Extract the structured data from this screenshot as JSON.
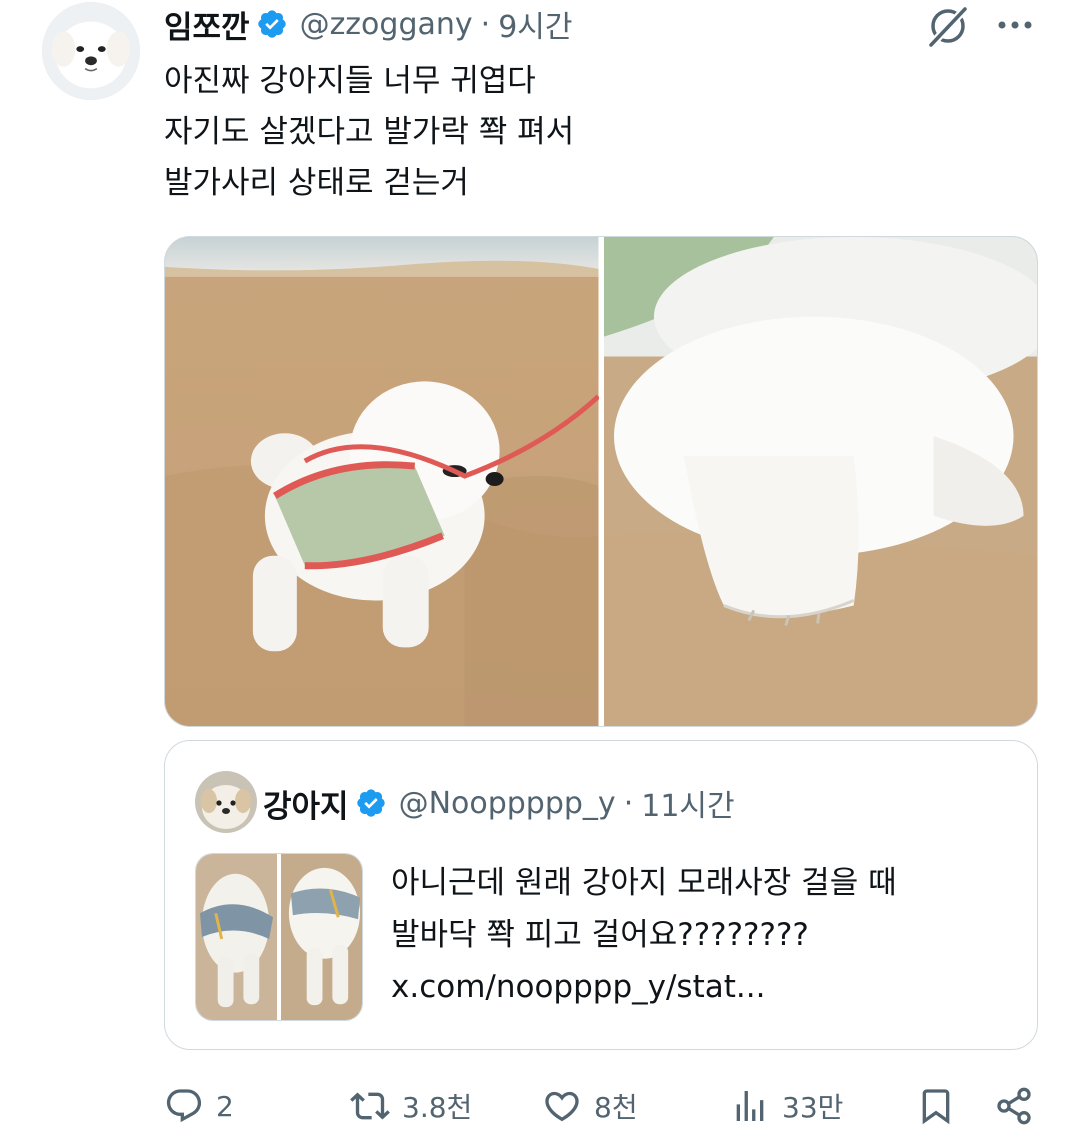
{
  "post": {
    "author": {
      "display_name": "임쪼깐",
      "handle": "@zzoggany",
      "verified": true,
      "avatar_icon": "white-dog-avatar"
    },
    "separator": "·",
    "time": "9시간",
    "text_lines": [
      "아진짜 강아지들 너무 귀엽다",
      "자기도 살겠다고 발가락 쫙 펴서",
      "발가사리 상태로 걷는거"
    ],
    "media": [
      {
        "kind": "photo",
        "subject": "white-dog-on-beach"
      },
      {
        "kind": "photo",
        "subject": "dog-paw-closeup"
      }
    ]
  },
  "quoted": {
    "author": {
      "display_name": "강아지",
      "handle": "@Nooppppp_y",
      "verified": true,
      "avatar_icon": "dog-avatar"
    },
    "separator": "·",
    "time": "11시간",
    "text_lines": [
      "아니근데 원래 강아지 모래사장 걸을 때",
      "발바닥 쫙 피고 걸어요????????",
      "x.com/noopppp_y/stat..."
    ],
    "media": [
      {
        "kind": "photo",
        "subject": "dog-in-harness"
      },
      {
        "kind": "photo",
        "subject": "dog-on-sand"
      }
    ]
  },
  "actions": {
    "reply_count": "2",
    "retweet_count": "3.8천",
    "like_count": "8천",
    "views_count": "33만"
  },
  "colors": {
    "text": "#0f1419",
    "secondary": "#536471",
    "border": "#cfd9de",
    "verified": "#1d9bf0"
  }
}
